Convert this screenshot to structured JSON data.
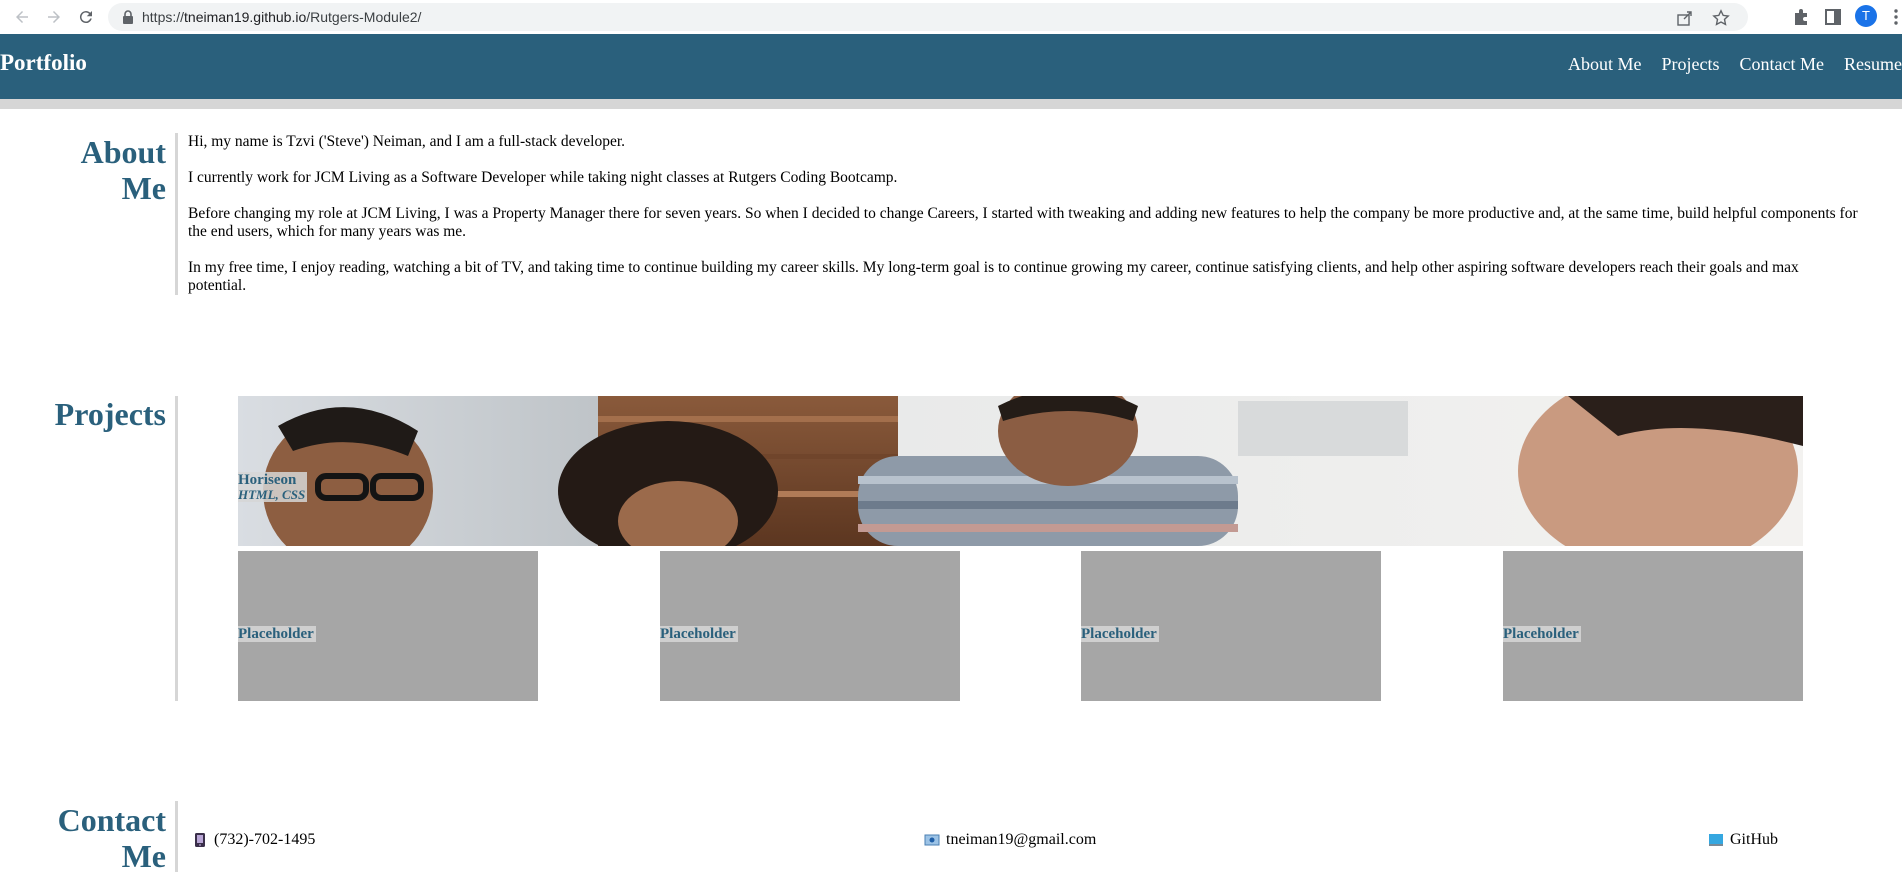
{
  "browser": {
    "url_scheme": "https://",
    "url_host": "tneiman19.github.io",
    "url_path": "/Rutgers-Module2/",
    "profile_initial": "T"
  },
  "header": {
    "brand": "Portfolio",
    "nav": [
      "About Me",
      "Projects",
      "Contact Me",
      "Resume"
    ]
  },
  "about": {
    "title_line1": "About",
    "title_line2": "Me",
    "paragraphs": [
      "Hi, my name is Tzvi ('Steve') Neiman, and I am a full-stack developer.",
      "I currently work for JCM Living as a Software Developer while taking night classes at Rutgers Coding Bootcamp.",
      "Before changing my role at JCM Living, I was a Property Manager there for seven years. So when I decided to change Careers, I started with tweaking and adding new features to help the company be more productive and, at the same time, build helpful components for the end users, which for many years was me.",
      "In my free time, I enjoy reading, watching a bit of TV, and taking time to continue building my career skills. My long-term goal is to continue growing my career, continue satisfying clients, and help other aspiring software developers reach their goals and max potential."
    ]
  },
  "projects": {
    "title": "Projects",
    "featured": {
      "name": "Horiseon",
      "tech": "HTML, CSS"
    },
    "placeholders": [
      "Placeholder",
      "Placeholder",
      "Placeholder",
      "Placeholder"
    ]
  },
  "contact": {
    "title_line1": "Contact",
    "title_line2": "Me",
    "phone": "(732)-702-1495",
    "email": "tneiman19@gmail.com",
    "github": "GitHub"
  },
  "colors": {
    "header_bg": "#2a607c",
    "accent_text": "#2a607c",
    "placeholder_bg": "#a6a6a6",
    "rule": "#d6d6d6"
  }
}
